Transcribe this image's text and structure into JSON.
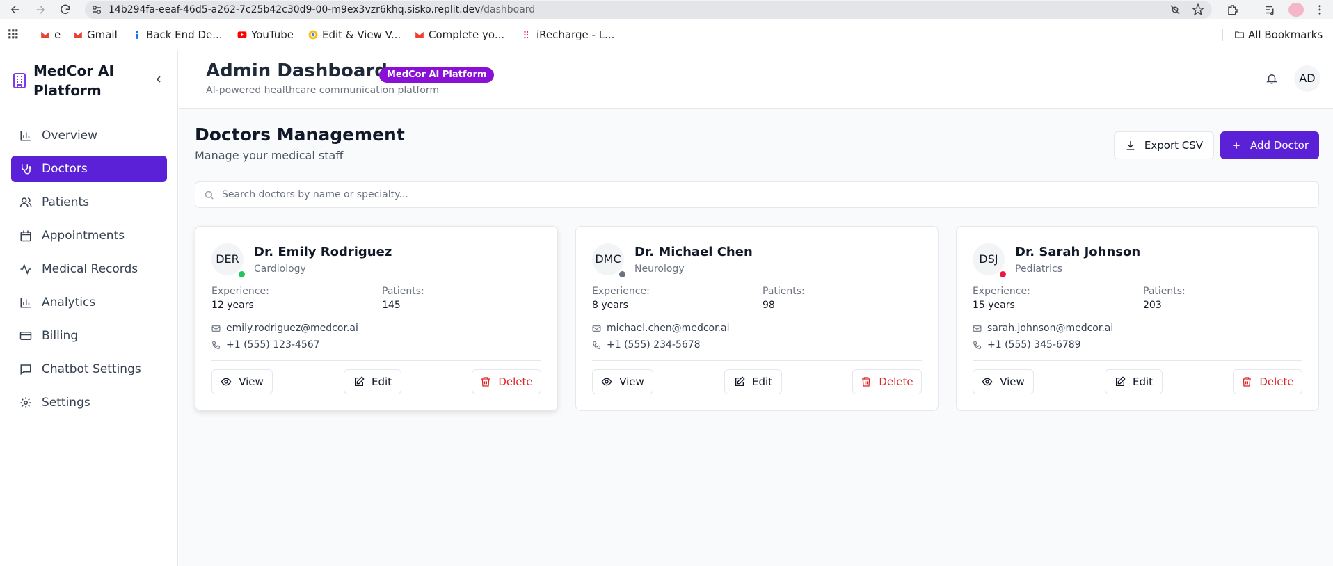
{
  "browser": {
    "url_host": "14b294fa-eeaf-46d5-a262-7c25b42c30d9-00-m9ex3vzr6khq.sisko.replit.dev",
    "url_path": "/dashboard",
    "bookmarks": [
      "e",
      "Gmail",
      "Back End De...",
      "YouTube",
      "Edit & View V...",
      "Complete yo...",
      "iRecharge - L..."
    ],
    "all_bookmarks": "All Bookmarks"
  },
  "sidebar": {
    "brand": "MedCor AI Platform",
    "items": [
      {
        "label": "Overview",
        "icon": "bar-chart-icon"
      },
      {
        "label": "Doctors",
        "icon": "stethoscope-icon",
        "active": true
      },
      {
        "label": "Patients",
        "icon": "users-icon"
      },
      {
        "label": "Appointments",
        "icon": "calendar-icon"
      },
      {
        "label": "Medical Records",
        "icon": "activity-icon"
      },
      {
        "label": "Analytics",
        "icon": "bar-chart-icon"
      },
      {
        "label": "Billing",
        "icon": "credit-card-icon"
      },
      {
        "label": "Chatbot Settings",
        "icon": "chat-icon"
      },
      {
        "label": "Settings",
        "icon": "gear-icon"
      }
    ]
  },
  "header": {
    "title": "Admin Dashboard",
    "badge": "MedCor AI Platform",
    "subtitle": "AI-powered healthcare communication platform",
    "avatar": "AD"
  },
  "main": {
    "title": "Doctors Management",
    "subtitle": "Manage your medical staff",
    "export_label": "Export CSV",
    "add_label": "Add Doctor",
    "search_placeholder": "Search doctors by name or specialty...",
    "experience_label": "Experience:",
    "patients_label": "Patients:",
    "view_label": "View",
    "edit_label": "Edit",
    "delete_label": "Delete",
    "doctors": [
      {
        "initials": "DER",
        "name": "Dr. Emily Rodriguez",
        "specialty": "Cardiology",
        "experience": "12 years",
        "patients": "145",
        "email": "emily.rodriguez@medcor.ai",
        "phone": "+1 (555) 123-4567",
        "status_color": "#22c55e"
      },
      {
        "initials": "DMC",
        "name": "Dr. Michael Chen",
        "specialty": "Neurology",
        "experience": "8 years",
        "patients": "98",
        "email": "michael.chen@medcor.ai",
        "phone": "+1 (555) 234-5678",
        "status_color": "#6b7280"
      },
      {
        "initials": "DSJ",
        "name": "Dr. Sarah Johnson",
        "specialty": "Pediatrics",
        "experience": "15 years",
        "patients": "203",
        "email": "sarah.johnson@medcor.ai",
        "phone": "+1 (555) 345-6789",
        "status_color": "#ef1845"
      }
    ]
  },
  "colors": {
    "primary": "#5b21d6",
    "badge": "#8b10d6",
    "brand_icon": "#7c3aed",
    "danger": "#dc2626"
  }
}
